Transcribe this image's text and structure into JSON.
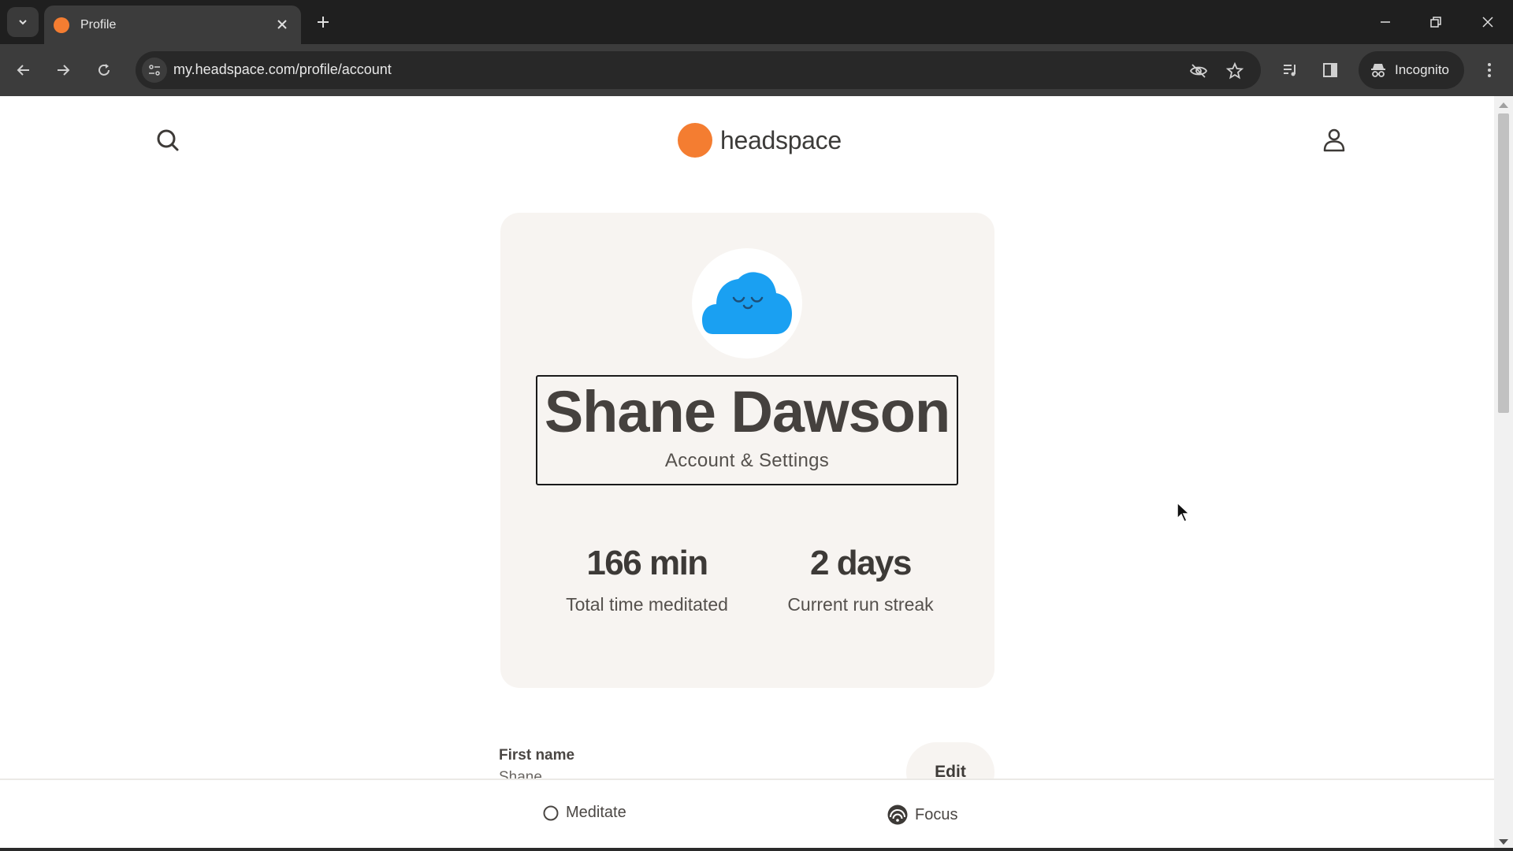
{
  "browser": {
    "tab": {
      "title": "Profile",
      "favicon_color": "#f47d31"
    },
    "url": "my.headspace.com/profile/account",
    "incognito_label": "Incognito",
    "icons": {
      "tab_search": "chevron-down-icon",
      "tab_close": "close-icon",
      "new_tab": "plus-icon",
      "minimize": "minimize-icon",
      "restore": "restore-icon",
      "close_window": "close-icon",
      "back": "back-arrow-icon",
      "forward": "forward-arrow-icon",
      "reload": "reload-icon",
      "site_info": "tune-icon",
      "eye_off": "eye-off-icon",
      "bookmark": "star-icon",
      "media": "media-queue-icon",
      "side_panel": "side-panel-icon",
      "incognito": "incognito-icon",
      "menu": "kebab-menu-icon"
    }
  },
  "header": {
    "logo_text": "headspace",
    "brand_color": "#f47d31"
  },
  "profile": {
    "name": "Shane Dawson",
    "subtitle": "Account & Settings",
    "avatar_color": "#1aa0f2",
    "stats": [
      {
        "value": "166 min",
        "label": "Total time meditated"
      },
      {
        "value": "2 days",
        "label": "Current run streak"
      }
    ]
  },
  "fields": [
    {
      "label": "First name",
      "value": "Shane",
      "action": "Edit"
    }
  ],
  "bottom_nav": [
    {
      "label": "Meditate",
      "icon": "circle-icon"
    },
    {
      "label": "Focus",
      "icon": "focus-icon"
    }
  ]
}
